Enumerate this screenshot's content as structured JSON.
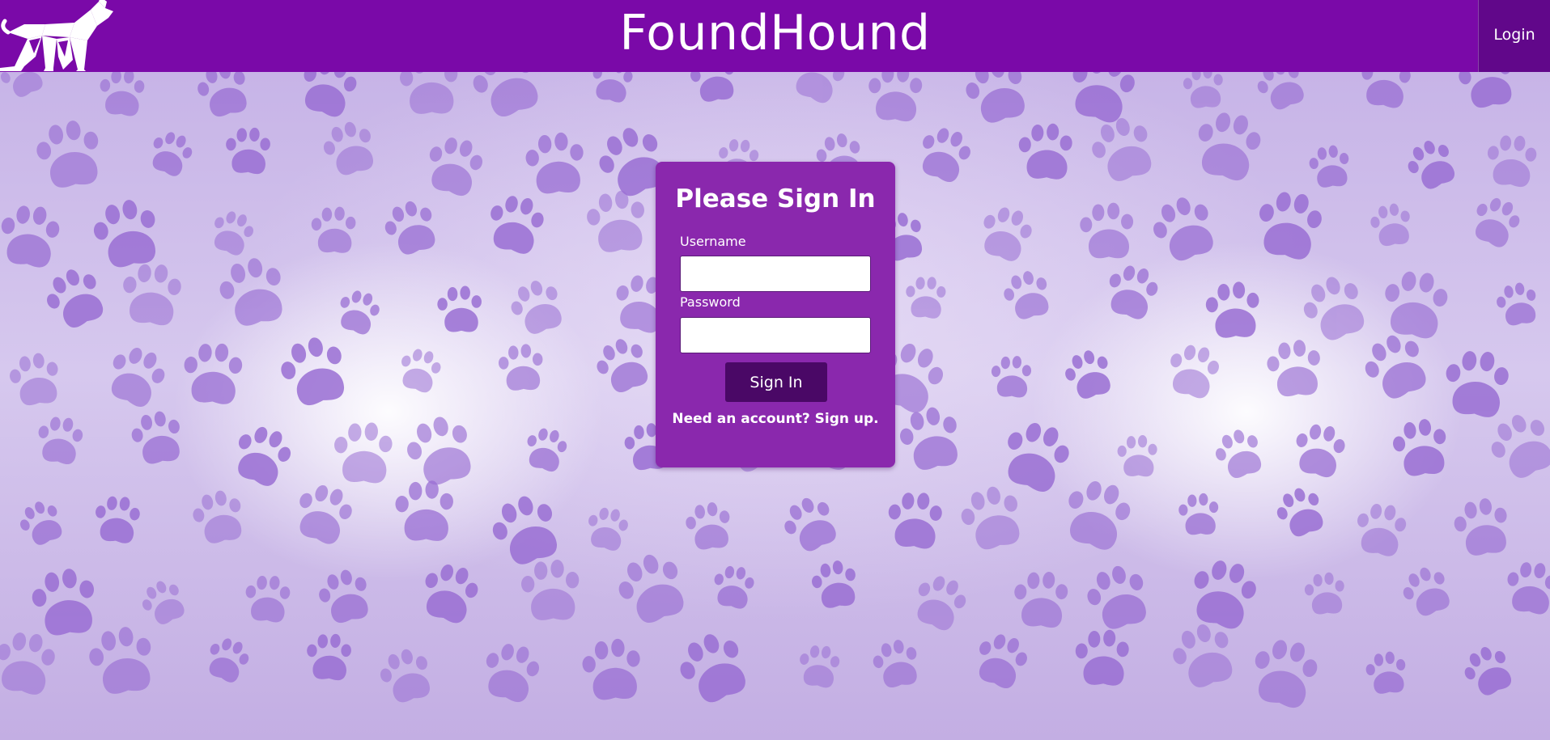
{
  "header": {
    "brand": "FoundHound",
    "login_label": "Login",
    "logo_icon": "dog-logo-icon",
    "background_color": "#7a09a8",
    "login_background_color": "#61078a"
  },
  "background": {
    "pattern_icon": "paw-print-icon",
    "paw_color": "#9a6fd4"
  },
  "signin": {
    "title": "Please Sign In",
    "username_label": "Username",
    "username_value": "",
    "password_label": "Password",
    "password_value": "",
    "submit_label": "Sign In",
    "signup_prompt": "Need an account? Sign up.",
    "card_color": "#8a28ad",
    "button_color": "#4a0866"
  }
}
